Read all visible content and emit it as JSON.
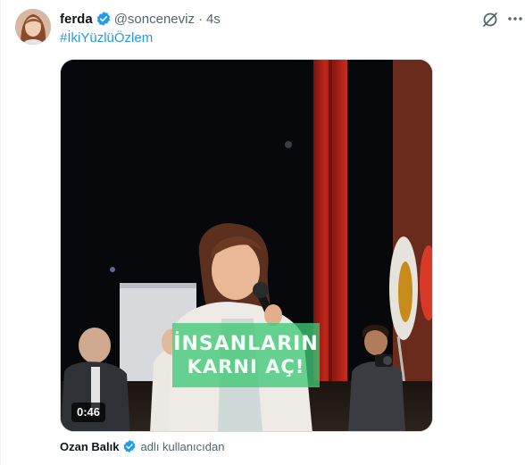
{
  "post": {
    "author": {
      "display_name": "ferda",
      "handle": "@sonceneviz",
      "verified": true,
      "avatar": "profile-photo"
    },
    "separator": "·",
    "timestamp": "4s",
    "hashtag": "#İkiYüzlüÖzlem",
    "icons": {
      "grok": "grok-icon",
      "more": "more-icon",
      "verified": "verified-badge-icon"
    },
    "media": {
      "type": "video",
      "caption_overlay": [
        "İNSANLARIN",
        "KARNI AÇ!"
      ],
      "duration": "0:46"
    },
    "attribution": {
      "user": "Ozan Balık",
      "verified": true,
      "suffix": "adlı kullanıcıdan"
    }
  },
  "colors": {
    "accent": "#1d9bf0",
    "secondary_text": "#536471",
    "primary_text": "#0f1419",
    "overlay_green": "#3fc876"
  }
}
